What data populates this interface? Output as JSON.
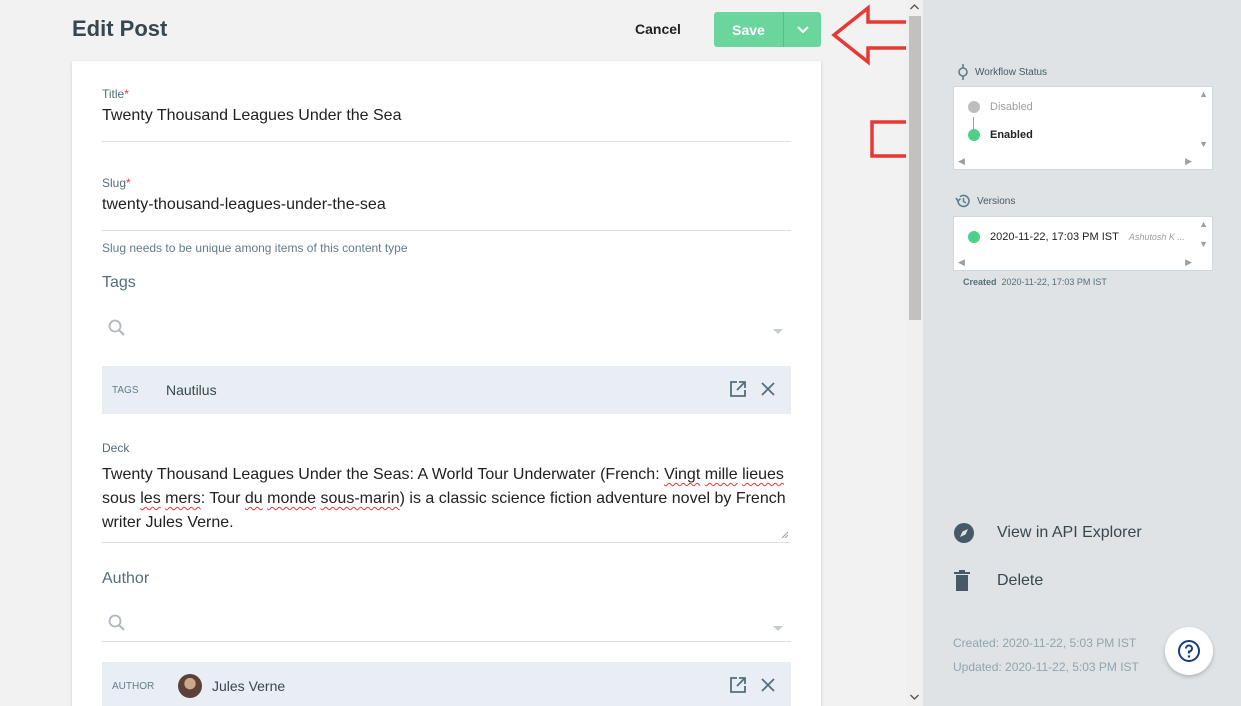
{
  "header": {
    "title": "Edit Post",
    "cancel_label": "Cancel",
    "save_label": "Save"
  },
  "form": {
    "title": {
      "label": "Title",
      "required_mark": "*",
      "value": "Twenty Thousand Leagues Under the Sea"
    },
    "slug": {
      "label": "Slug",
      "required_mark": "*",
      "value": "twenty-thousand-leagues-under-the-sea",
      "hint": "Slug needs to be unique among items of this content type"
    },
    "tags": {
      "title": "Tags",
      "chip_label": "TAGS",
      "chip_value": "Nautilus"
    },
    "deck": {
      "label": "Deck",
      "segments": [
        "Twenty Thousand Leagues Under the Seas: A World Tour Underwater (French: ",
        "Vingt",
        " ",
        "mille",
        " ",
        "lieues",
        " sous ",
        "les",
        " ",
        "mers",
        ": Tour ",
        "du",
        " ",
        "monde",
        " ",
        "sous-marin",
        ") is a classic science fiction adventure novel by French writer Jules Verne."
      ]
    },
    "author": {
      "title": "Author",
      "chip_label": "AUTHOR",
      "chip_value": "Jules Verne"
    }
  },
  "side": {
    "workflow_label": "Workflow Status",
    "workflow_items": [
      {
        "label": "Disabled",
        "color": "#bdbdbd"
      },
      {
        "label": "Enabled",
        "color": "#4cd08a"
      }
    ],
    "versions_label": "Versions",
    "version": {
      "timestamp": "2020-11-22, 17:03 PM IST",
      "author": "Ashutosh K ...",
      "color": "#4cd08a"
    },
    "created_label": "Created",
    "created_value": "2020-11-22, 17:03 PM IST",
    "api_explorer_label": "View in API Explorer",
    "delete_label": "Delete",
    "meta_created": "Created: 2020-11-22, 5:03 PM IST",
    "meta_updated": "Updated: 2020-11-22, 5:03 PM IST"
  },
  "colors": {
    "accent_green": "#6ad69d",
    "annotation_red": "#e53935"
  }
}
